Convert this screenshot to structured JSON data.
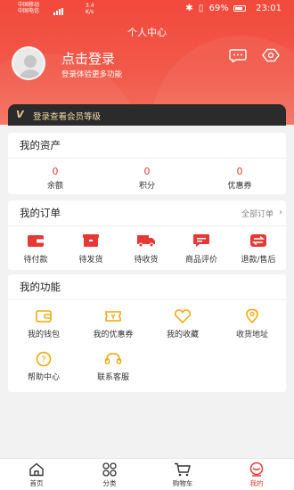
{
  "status_bar": {
    "carrier1": "中国移动",
    "carrier2": "中国电信",
    "net1": "HD",
    "net2": "HD",
    "speed_value": "3.4",
    "speed_unit": "K/s",
    "battery": "69%",
    "time": "23:01"
  },
  "header": {
    "title": "个人中心",
    "login_title": "点击登录",
    "login_subtitle": "登录体验更多功能"
  },
  "member_bar": {
    "badge": "V",
    "text": "登录查看会员等级"
  },
  "assets": {
    "title": "我的资产",
    "items": [
      {
        "value": "0",
        "label": "余额"
      },
      {
        "value": "0",
        "label": "积分"
      },
      {
        "value": "0",
        "label": "优惠券"
      }
    ]
  },
  "orders": {
    "title": "我的订单",
    "all_label": "全部订单",
    "items": [
      {
        "label": "待付款",
        "icon": "wallet-icon"
      },
      {
        "label": "待发货",
        "icon": "box-icon"
      },
      {
        "label": "待收货",
        "icon": "truck-icon"
      },
      {
        "label": "商品评价",
        "icon": "comment-icon"
      },
      {
        "label": "退款/售后",
        "icon": "refund-icon"
      }
    ]
  },
  "functions": {
    "title": "我的功能",
    "items": [
      {
        "label": "我的钱包",
        "icon": "wallet-icon"
      },
      {
        "label": "我的优惠券",
        "icon": "coupon-icon"
      },
      {
        "label": "我的收藏",
        "icon": "heart-icon"
      },
      {
        "label": "收货地址",
        "icon": "location-icon"
      },
      {
        "label": "帮助中心",
        "icon": "help-icon"
      },
      {
        "label": "联系客服",
        "icon": "service-icon"
      }
    ]
  },
  "tabs": [
    {
      "label": "首页",
      "icon": "home-icon"
    },
    {
      "label": "分类",
      "icon": "category-icon"
    },
    {
      "label": "购物车",
      "icon": "cart-icon"
    },
    {
      "label": "我的",
      "icon": "profile-icon",
      "active": true
    }
  ],
  "colors": {
    "accent": "#e53935",
    "header": "#f2493c",
    "icon_gold": "#f0a500"
  }
}
